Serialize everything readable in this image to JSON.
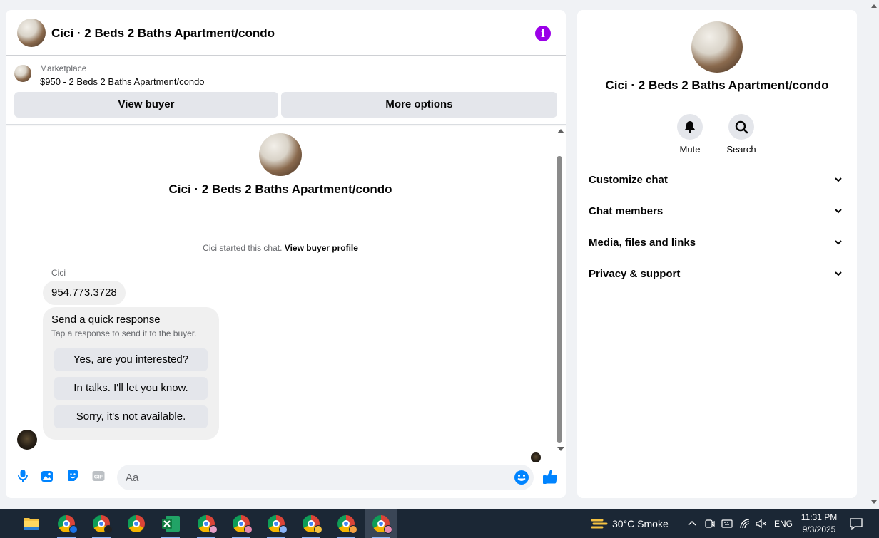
{
  "chat": {
    "title": "Cici · 2 Beds 2 Baths Apartment/condo",
    "listing": {
      "source": "Marketplace",
      "item": "$950 - 2 Beds 2 Baths Apartment/condo",
      "view_buyer": "View buyer",
      "more_options": "More options"
    },
    "intro_title": "Cici · 2 Beds 2 Baths Apartment/condo",
    "started_text": "Cici started this chat.",
    "started_link": "View buyer profile",
    "sender": "Cici",
    "message": "954.773.3728",
    "quick_response": {
      "title": "Send a quick response",
      "subtitle": "Tap a response to send it to the buyer.",
      "options": [
        "Yes, are you interested?",
        "In talks. I'll let you know.",
        "Sorry, it's not available."
      ]
    },
    "composer_placeholder": "Aa"
  },
  "side": {
    "title": "Cici · 2 Beds 2 Baths Apartment/condo",
    "actions": [
      {
        "label": "Mute",
        "icon": "bell-icon"
      },
      {
        "label": "Search",
        "icon": "search-icon"
      }
    ],
    "sections": [
      "Customize chat",
      "Chat members",
      "Media, files and links",
      "Privacy & support"
    ]
  },
  "taskbar": {
    "weather": "30°C  Smoke",
    "language": "ENG",
    "time": "11:31 PM",
    "date": "9/3/2025"
  },
  "colors": {
    "accent": "#0084ff",
    "info": "#9b00e8",
    "taskbar": "#1b2735"
  }
}
